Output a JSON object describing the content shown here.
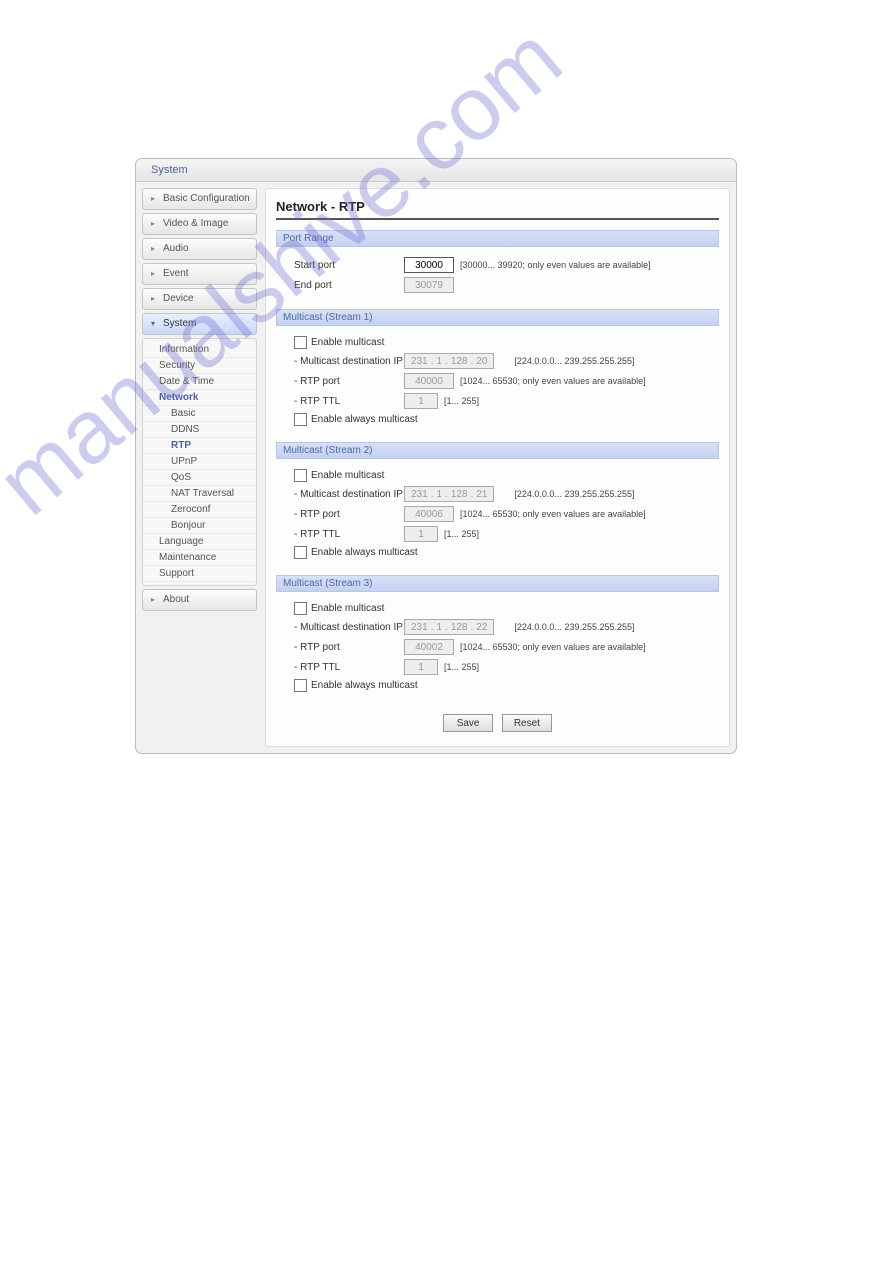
{
  "header": {
    "title": "System"
  },
  "sidebar": {
    "items": [
      "Basic Configuration",
      "Video & Image",
      "Audio",
      "Event",
      "Device",
      "System",
      "About"
    ],
    "active_index": 5,
    "tree": {
      "information": "Information",
      "security": "Security",
      "datetime": "Date & Time",
      "network": "Network",
      "sub": {
        "basic": "Basic",
        "ddns": "DDNS",
        "rtp": "RTP",
        "upnp": "UPnP",
        "qos": "QoS",
        "nat": "NAT Traversal",
        "zeroconf": "Zeroconf",
        "bonjour": "Bonjour"
      },
      "language": "Language",
      "maintenance": "Maintenance",
      "support": "Support"
    }
  },
  "page": {
    "title": "Network - RTP",
    "port_range": {
      "head": "Port Range",
      "start_label": "Start port",
      "start_value": "30000",
      "start_hint": "[30000... 39920; only even values are available]",
      "end_label": "End port",
      "end_value": "30079"
    },
    "streams": [
      {
        "head": "Multicast (Stream 1)",
        "enable_label": "Enable multicast",
        "ip_label": "Multicast destination IP",
        "ip": [
          "231",
          "1",
          "128",
          "20"
        ],
        "ip_hint": "[224.0.0.0... 239.255.255.255]",
        "port_label": "RTP port",
        "port_value": "40000",
        "port_hint": "[1024... 65530; only even values are available]",
        "ttl_label": "RTP TTL",
        "ttl_value": "1",
        "ttl_hint": "[1... 255]",
        "always_label": "Enable always multicast"
      },
      {
        "head": "Multicast (Stream 2)",
        "enable_label": "Enable multicast",
        "ip_label": "Multicast destination IP",
        "ip": [
          "231",
          "1",
          "128",
          "21"
        ],
        "ip_hint": "[224.0.0.0... 239.255.255.255]",
        "port_label": "RTP port",
        "port_value": "40006",
        "port_hint": "[1024... 65530; only even values are available]",
        "ttl_label": "RTP TTL",
        "ttl_value": "1",
        "ttl_hint": "[1... 255]",
        "always_label": "Enable always multicast"
      },
      {
        "head": "Multicast (Stream 3)",
        "enable_label": "Enable multicast",
        "ip_label": "Multicast destination IP",
        "ip": [
          "231",
          "1",
          "128",
          "22"
        ],
        "ip_hint": "[224.0.0.0... 239.255.255.255]",
        "port_label": "RTP port",
        "port_value": "40002",
        "port_hint": "[1024... 65530; only even values are available]",
        "ttl_label": "RTP TTL",
        "ttl_value": "1",
        "ttl_hint": "[1... 255]",
        "always_label": "Enable always multicast"
      }
    ],
    "buttons": {
      "save": "Save",
      "reset": "Reset"
    }
  },
  "watermark": "manualshive.com"
}
